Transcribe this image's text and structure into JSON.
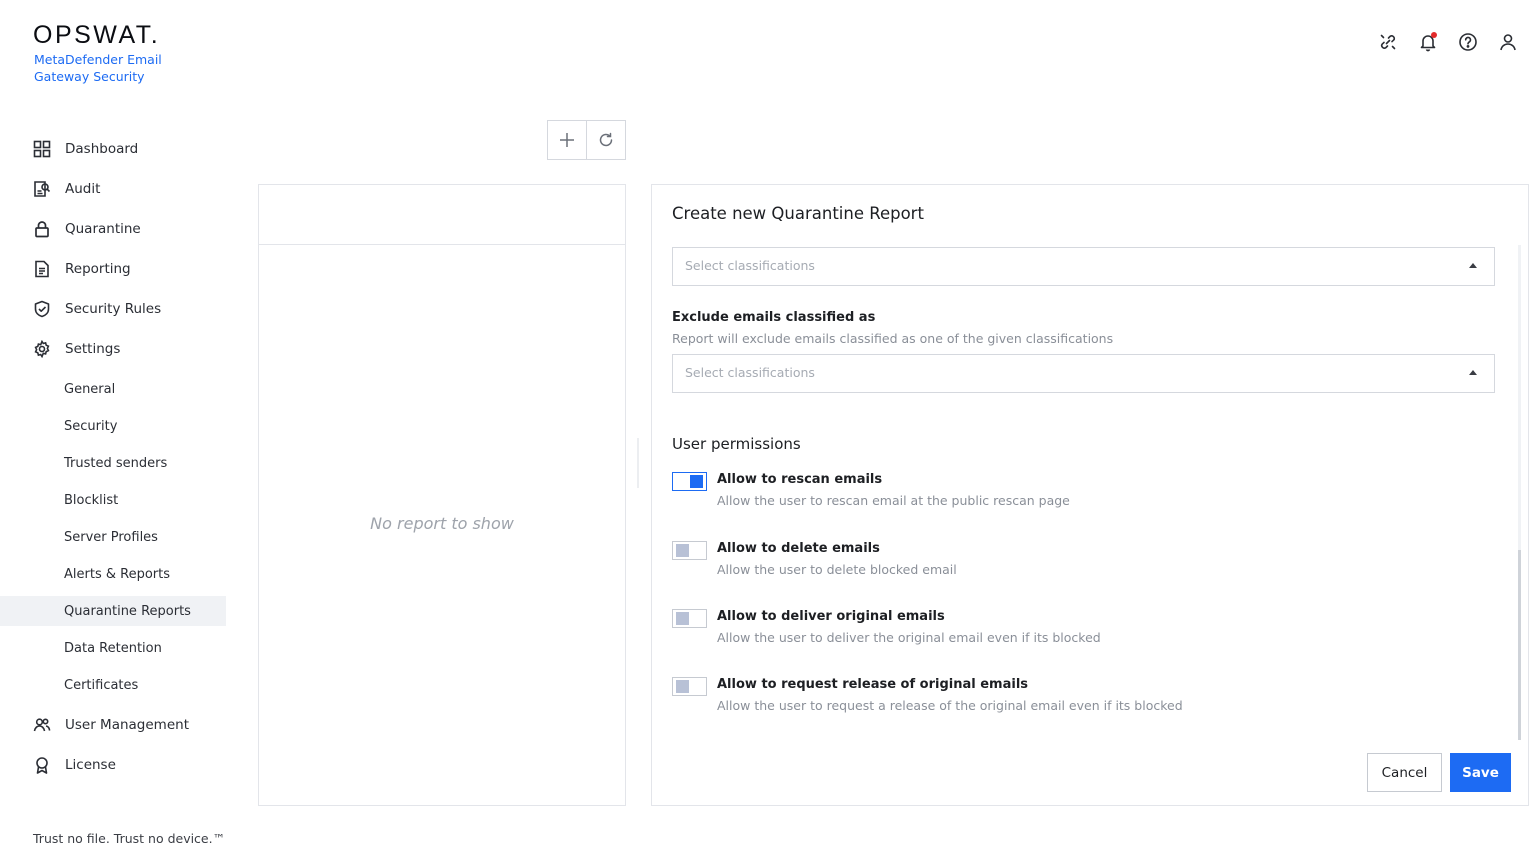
{
  "brand": {
    "logo": "OPSWAT.",
    "product": "MetaDefender Email Gateway Security"
  },
  "topbar": {
    "icons": [
      "link-icon",
      "bell-icon",
      "help-icon",
      "user-icon"
    ],
    "notification_dot_color": "#e32a2a"
  },
  "sidebar": {
    "items": [
      {
        "label": "Dashboard",
        "icon": "dashboard-icon"
      },
      {
        "label": "Audit",
        "icon": "audit-icon"
      },
      {
        "label": "Quarantine",
        "icon": "lock-icon"
      },
      {
        "label": "Reporting",
        "icon": "document-icon"
      },
      {
        "label": "Security Rules",
        "icon": "shield-check-icon"
      },
      {
        "label": "Settings",
        "icon": "gear-icon"
      }
    ],
    "settings_subitems": [
      {
        "label": "General"
      },
      {
        "label": "Security"
      },
      {
        "label": "Trusted senders"
      },
      {
        "label": "Blocklist"
      },
      {
        "label": "Server Profiles"
      },
      {
        "label": "Alerts & Reports"
      },
      {
        "label": "Quarantine Reports",
        "active": true
      },
      {
        "label": "Data Retention"
      },
      {
        "label": "Certificates"
      }
    ],
    "bottom_items": [
      {
        "label": "User Management",
        "icon": "users-icon"
      },
      {
        "label": "License",
        "icon": "award-icon"
      }
    ],
    "tagline": "Trust no file. Trust no device.™"
  },
  "list": {
    "empty_text": "No report to show"
  },
  "form": {
    "title": "Create new Quarantine Report",
    "include_select": {
      "placeholder": "Select classifications"
    },
    "exclude": {
      "label": "Exclude emails classified as",
      "help": "Report will exclude emails classified as one of the given classifications",
      "placeholder": "Select classifications"
    },
    "permissions_title": "User permissions",
    "permissions": [
      {
        "title": "Allow to rescan emails",
        "desc": "Allow the user to rescan email at the public rescan page",
        "enabled": true
      },
      {
        "title": "Allow to delete emails",
        "desc": "Allow the user to delete blocked email",
        "enabled": false
      },
      {
        "title": "Allow to deliver original emails",
        "desc": "Allow the user to deliver the original email even if its blocked",
        "enabled": false
      },
      {
        "title": "Allow to request release of original emails",
        "desc": "Allow the user to request a release of the original email even if its blocked",
        "enabled": false
      }
    ],
    "cancel_label": "Cancel",
    "save_label": "Save"
  },
  "colors": {
    "accent": "#1d6bf3",
    "toggle_off_knob": "#b8c1d6",
    "active_nav_bg": "#f0f2f5"
  }
}
